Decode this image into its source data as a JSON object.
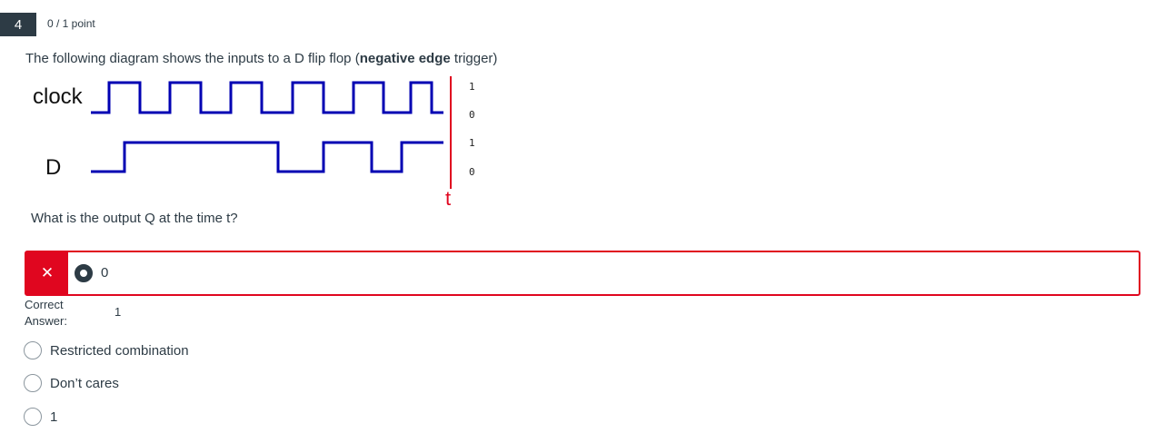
{
  "question": {
    "number": "4",
    "points": "0 / 1 point",
    "prompt_before": "The following diagram shows the inputs to a D flip flop (",
    "prompt_bold": "negative edge",
    "prompt_after": " trigger)",
    "question_text": "What is the output Q at the time t?"
  },
  "diagram": {
    "clock_label": "clock",
    "d_label": "D",
    "time_label": "t",
    "clock_high": "1",
    "clock_low": "0",
    "d_high": "1",
    "d_low": "0",
    "wave_color": "#0000b3",
    "marker_color": "#e0061f"
  },
  "selected_answer": {
    "status_icon": "x-icon",
    "status_symbol": "✕",
    "label": "0"
  },
  "correct": {
    "label_line1": "Correct",
    "label_line2": "Answer:",
    "value": "1"
  },
  "options": [
    {
      "label": "Restricted combination"
    },
    {
      "label": "Don’t cares"
    },
    {
      "label": "1"
    }
  ],
  "colors": {
    "incorrect": "#e0061f",
    "text": "#2d3b45"
  }
}
